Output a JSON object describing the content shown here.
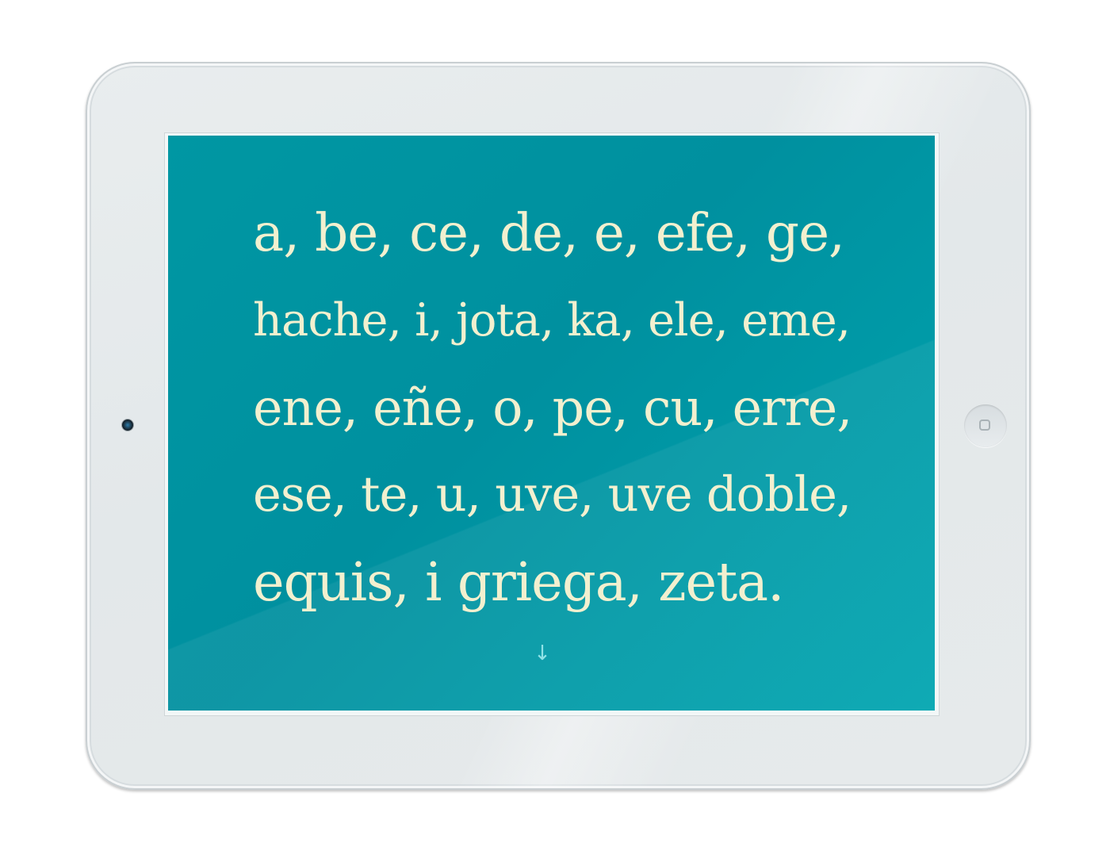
{
  "device": {
    "camera_icon": "camera-icon",
    "home_button_icon": "home-square-icon"
  },
  "screen": {
    "colors": {
      "background": "#0097a3",
      "text": "#f2f0cf",
      "arrow": "#8fe2e6"
    },
    "alphabet_lines": [
      "a, be, ce, de, e, efe, ge,",
      "hache, i, jota, ka, ele, eme,",
      "ene, eñe, o, pe, cu, erre,",
      "ese, te, u, uve, uve doble,",
      "equis, i griega, zeta."
    ],
    "scroll_arrow": "↓"
  }
}
